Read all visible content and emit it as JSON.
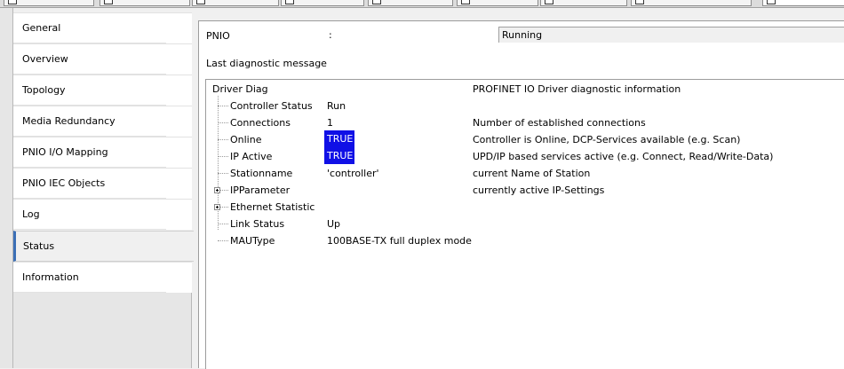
{
  "colors": {
    "highlight": "#1010e6",
    "nav_accent": "#3b6fb6"
  },
  "nav": {
    "items": [
      {
        "label": "General"
      },
      {
        "label": "Overview"
      },
      {
        "label": "Topology"
      },
      {
        "label": "Media Redundancy"
      },
      {
        "label": "PNIO I/O Mapping"
      },
      {
        "label": "PNIO IEC Objects"
      },
      {
        "label": "Log"
      },
      {
        "label": "Status"
      },
      {
        "label": "Information"
      }
    ],
    "selected": "Status"
  },
  "status": {
    "label": "PNIO",
    "separator": ":",
    "value": "Running"
  },
  "last_diag": {
    "label": "Last diagnostic message"
  },
  "diag": {
    "root": {
      "name": "Driver Diag",
      "description": "PROFINET IO Driver diagnostic information"
    },
    "rows": [
      {
        "name": "Controller Status",
        "value": "Run",
        "description": ""
      },
      {
        "name": "Connections",
        "value": "1",
        "description": "Number of established connections"
      },
      {
        "name": "Online",
        "value": "TRUE",
        "description": "Controller is Online, DCP-Services available (e.g. Scan)"
      },
      {
        "name": "IP Active",
        "value": "TRUE",
        "description": "UPD/IP based services active (e.g. Connect, Read/Write-Data)"
      },
      {
        "name": "Stationname",
        "value": "'controller'",
        "description": "current Name of Station"
      },
      {
        "name": "IPParameter",
        "value": "",
        "description": "currently active IP-Settings"
      },
      {
        "name": "Ethernet Statistic",
        "value": "",
        "description": ""
      },
      {
        "name": "Link Status",
        "value": "Up",
        "description": ""
      },
      {
        "name": "MAUType",
        "value": "100BASE-TX full duplex mode",
        "description": ""
      }
    ]
  }
}
